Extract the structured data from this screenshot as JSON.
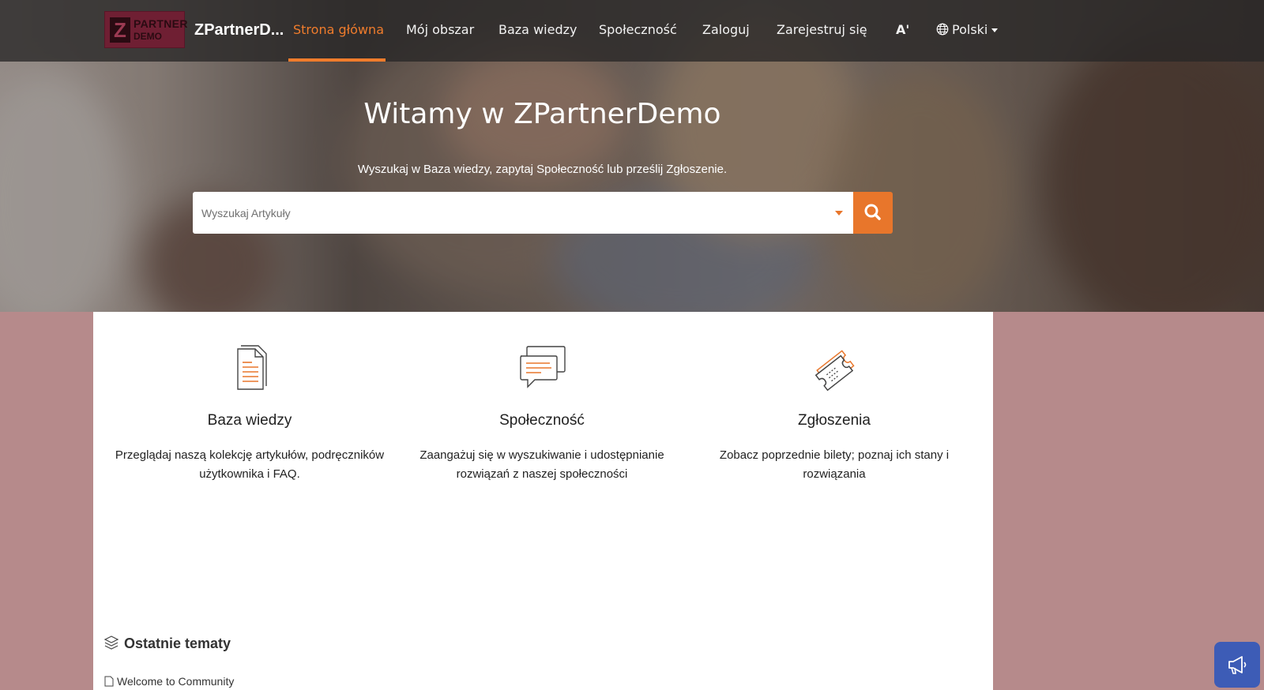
{
  "header": {
    "logo": {
      "letter": "Z",
      "line1": "PARTNER",
      "line2": "DEMO"
    },
    "brand": "ZPartnerD...",
    "nav": [
      {
        "label": "Strona główna",
        "active": true
      },
      {
        "label": "Mój obszar"
      },
      {
        "label": "Baza wiedzy"
      },
      {
        "label": "Społeczność"
      },
      {
        "label": "Zaloguj"
      },
      {
        "label": "Zarejestruj się"
      }
    ],
    "font_size_label": "A'",
    "language": "Polski"
  },
  "hero": {
    "title": "Witamy w ZPartnerDemo",
    "subtitle": "Wyszukaj w Baza wiedzy, zapytaj Społeczność lub prześlij Zgłoszenie.",
    "search_placeholder": "Wyszukaj Artykuły"
  },
  "features": [
    {
      "icon": "document-icon",
      "title": "Baza wiedzy",
      "desc": "Przeglądaj naszą kolekcję artykułów, podręczników użytkownika i FAQ."
    },
    {
      "icon": "chat-icon",
      "title": "Społeczność",
      "desc": "Zaangażuj się w wyszukiwanie i udostępnianie rozwiązań z naszej społeczności"
    },
    {
      "icon": "ticket-icon",
      "title": "Zgłoszenia",
      "desc": "Zobacz poprzednie bilety; poznaj ich stany i rozwiązania"
    }
  ],
  "recent": {
    "title": "Ostatnie tematy",
    "items": [
      "Welcome to Community"
    ]
  },
  "colors": {
    "accent": "#e8762b",
    "page_background": "#b68a8b",
    "announcement_button": "#3d5cb6"
  }
}
